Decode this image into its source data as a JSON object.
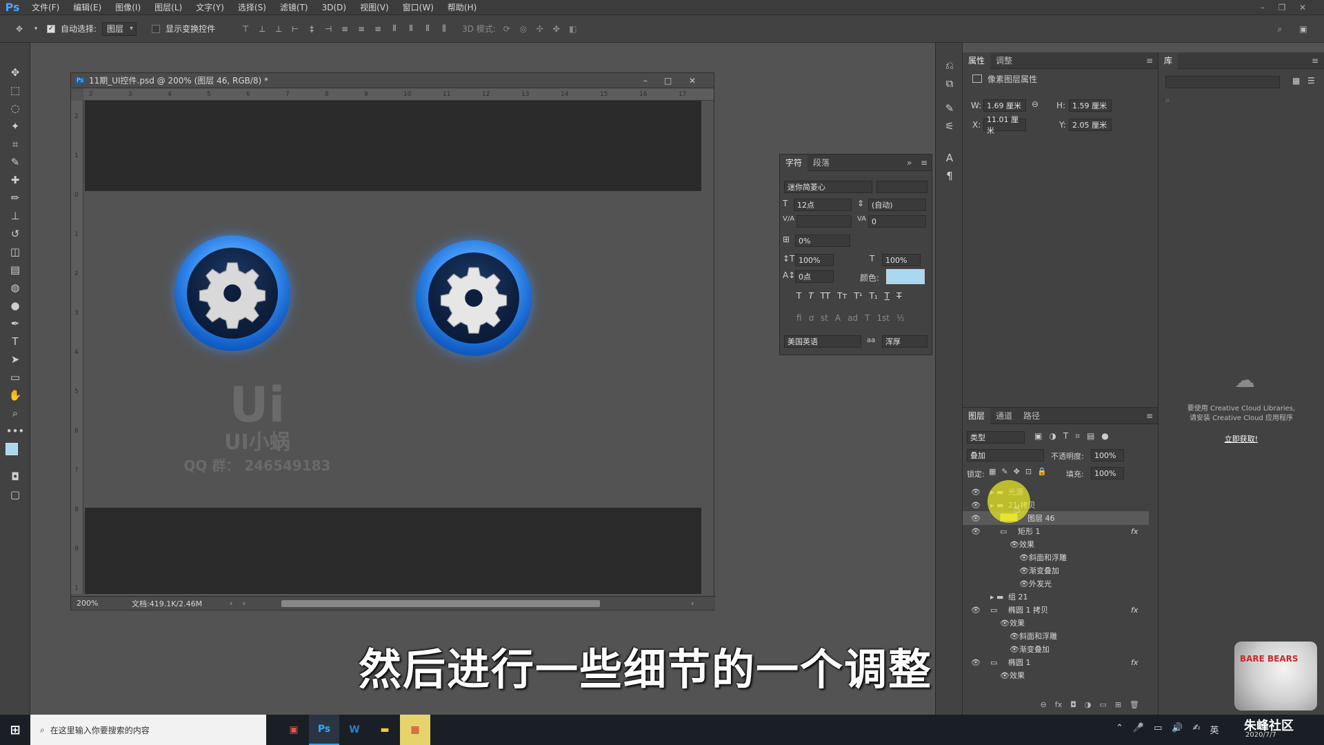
{
  "menubar": {
    "logo": "Ps",
    "items": [
      "文件(F)",
      "编辑(E)",
      "图像(I)",
      "图层(L)",
      "文字(Y)",
      "选择(S)",
      "滤镜(T)",
      "3D(D)",
      "视图(V)",
      "窗口(W)",
      "帮助(H)"
    ]
  },
  "options": {
    "auto_select_label": "自动选择:",
    "auto_select_value": "图层",
    "show_transform_label": "显示变换控件",
    "mode_3d_label": "3D 模式:"
  },
  "document": {
    "title": "11期_UI控件.psd @ 200% (图层 46, RGB/8) *",
    "zoom": "200%",
    "doc_info": "文档:419.1K/2.46M",
    "ruler_h": [
      "2",
      "3",
      "4",
      "5",
      "6",
      "7",
      "8",
      "9",
      "10",
      "11",
      "12",
      "13",
      "14",
      "15",
      "16",
      "17"
    ],
    "ruler_v": [
      "2",
      "1",
      "0",
      "1",
      "2",
      "3",
      "4",
      "5",
      "6",
      "7",
      "8",
      "9",
      "1"
    ]
  },
  "watermark": {
    "logo": "Ui",
    "name": "UI小蜗",
    "qq": "QQ 群： 246549183"
  },
  "char_panel": {
    "tabs": [
      "字符",
      "段落"
    ],
    "font": "迷你简菱心",
    "size": "12点",
    "leading": "(自动)",
    "kerning": "",
    "tracking": "0",
    "scale_pct": "0%",
    "vscale": "100%",
    "hscale": "100%",
    "baseline": "0点",
    "color_label": "颜色:",
    "language": "美国英语",
    "aa_label": "aa",
    "antialias": "浑厚",
    "text_color": "#aad8f0"
  },
  "properties": {
    "tabs": [
      "属性",
      "调整"
    ],
    "title": "像素图层属性",
    "w_label": "W:",
    "w_value": "1.69 厘米",
    "h_label": "H:",
    "h_value": "1.59 厘米",
    "x_label": "X:",
    "x_value": "11.01 厘米",
    "y_label": "Y:",
    "y_value": "2.05 厘米"
  },
  "libraries": {
    "tab": "库",
    "msg1": "要使用 Creative Cloud Libraries,",
    "msg2": "请安装 Creative Cloud 应用程序",
    "link": "立即获取!"
  },
  "layers": {
    "tabs": [
      "图层",
      "通道",
      "路径"
    ],
    "filter": "类型",
    "blend": "叠加",
    "opacity_label": "不透明度:",
    "opacity": "100%",
    "lock_label": "锁定:",
    "fill_label": "填充:",
    "fill": "100%",
    "rows": [
      {
        "name": "光源",
        "indent": 0
      },
      {
        "name": "21 拷贝",
        "indent": 0
      },
      {
        "name": "图层 46",
        "indent": 1
      },
      {
        "name": "矩形 1",
        "indent": 1
      },
      {
        "name": "效果",
        "indent": 2
      },
      {
        "name": "斜面和浮雕",
        "indent": 3
      },
      {
        "name": "渐变叠加",
        "indent": 3
      },
      {
        "name": "外发光",
        "indent": 3
      },
      {
        "name": "组 21",
        "indent": 0
      },
      {
        "name": "椭圆 1 拷贝",
        "indent": 0
      },
      {
        "name": "效果",
        "indent": 1
      },
      {
        "name": "斜面和浮雕",
        "indent": 2
      },
      {
        "name": "渐变叠加",
        "indent": 2
      },
      {
        "name": "椭圆 1",
        "indent": 0
      },
      {
        "name": "效果",
        "indent": 1
      }
    ]
  },
  "subtitle": "然后进行一些细节的一个调整",
  "taskbar": {
    "search_placeholder": "在这里输入你要搜索的内容",
    "ime": "英",
    "brand": "朱峰社区",
    "date": "2020/7/7"
  },
  "overlay": {
    "bear_text": "BARE BEARS"
  }
}
